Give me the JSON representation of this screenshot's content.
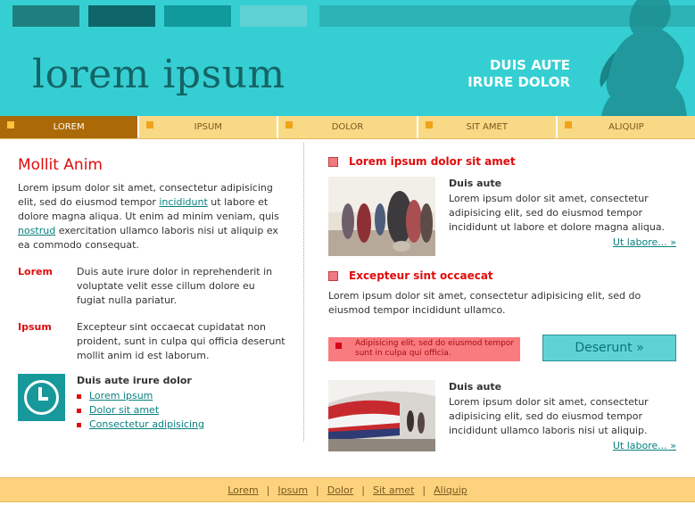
{
  "header": {
    "logo_text": "lorem ipsum",
    "tagline_line1": "DUIS AUTE",
    "tagline_line2": "IRURE DOLOR"
  },
  "nav": {
    "items": [
      {
        "label": "LOREM",
        "active": true
      },
      {
        "label": "IPSUM",
        "active": false
      },
      {
        "label": "DOLOR",
        "active": false
      },
      {
        "label": "SIT AMET",
        "active": false
      },
      {
        "label": "ALIQUIP",
        "active": false
      }
    ]
  },
  "left": {
    "heading": "Mollit Anim",
    "intro_part1": "Lorem ipsum dolor sit amet, consectetur adipisicing elit, sed do eiusmod tempor",
    "intro_link1": "incididunt",
    "intro_part2": "ut labore et dolore magna aliqua. Ut enim ad minim veniam, quis",
    "intro_link2": "nostrud",
    "intro_part3": "exercitation ullamco laboris nisi ut aliquip ex ea commodo consequat.",
    "definitions": [
      {
        "term": "Lorem",
        "text": "Duis aute irure dolor in reprehenderit in voluptate velit esse cillum dolore eu fugiat nulla pariatur."
      },
      {
        "term": "Ipsum",
        "text": "Excepteur sint occaecat cupidatat non proident, sunt in culpa qui officia deserunt mollit anim id est laborum."
      }
    ],
    "links_title": "Duis aute irure dolor",
    "links": [
      "Lorem ipsum",
      "Dolor sit amet",
      "Consectetur adipisicing"
    ]
  },
  "right": {
    "section1_title": "Lorem ipsum dolor sit amet",
    "feature1": {
      "title": "Duis aute",
      "text": "Lorem ipsum dolor sit amet, consectetur adipisicing elit, sed do eiusmod tempor incididunt ut labore et dolore magna aliqua.",
      "more": "Ut labore... »"
    },
    "section2_title": "Excepteur sint occaecat",
    "section2_text": "Lorem ipsum dolor sit amet, consectetur adipisicing elit, sed do eiusmod tempor incididunt ullamco.",
    "notice_text": "Adipisicing elit, sed do eiusmod tempor sunt in culpa qui officia.",
    "cta_label": "Deserunt »",
    "feature2": {
      "title": "Duis aute",
      "text": "Lorem ipsum dolor sit amet, consectetur adipisicing elit, sed do eiusmod tempor incididunt ullamco laboris nisi ut aliquip.",
      "more": "Ut labore... »"
    }
  },
  "footer": {
    "links": [
      "Lorem",
      "Ipsum",
      "Dolor",
      "Sit amet",
      "Aliquip"
    ]
  },
  "colors": {
    "header_bg": "#35cfd3",
    "nav_active": "#ab6a07",
    "nav_bg": "#f8d986",
    "accent_red": "#e10b0b",
    "link_teal": "#08807f"
  }
}
